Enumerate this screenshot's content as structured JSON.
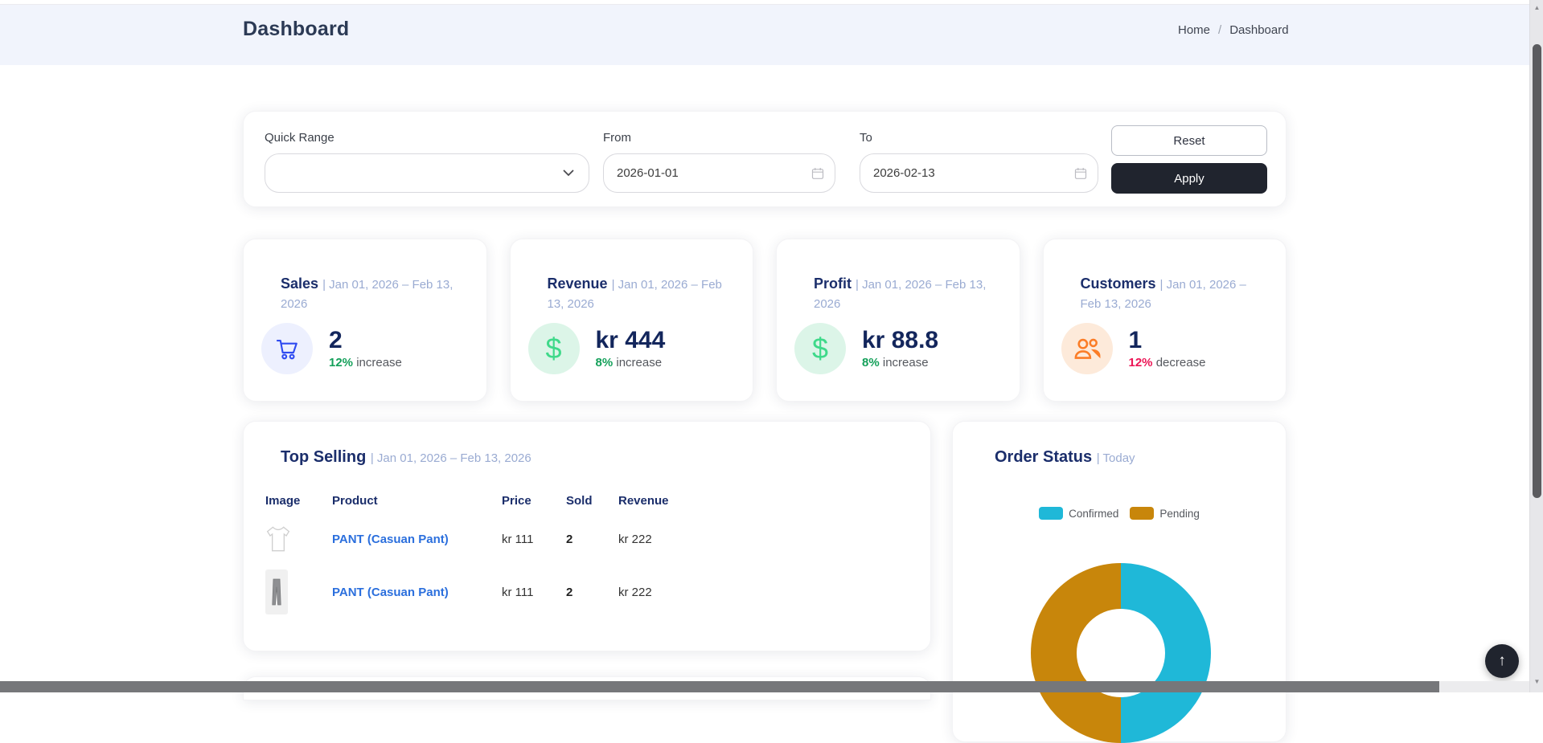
{
  "page": {
    "title": "Dashboard"
  },
  "breadcrumb": {
    "home": "Home",
    "separator": "/",
    "current": "Dashboard"
  },
  "filters": {
    "quick_range_label": "Quick Range",
    "quick_range_value": "",
    "from_label": "From",
    "from_value": "2026-01-01",
    "to_label": "To",
    "to_value": "2026-02-13",
    "reset_label": "Reset",
    "apply_label": "Apply"
  },
  "stats": [
    {
      "title": "Sales",
      "period": "| Jan 01, 2026 – Feb 13, 2026",
      "value": "2",
      "delta": "12%",
      "delta_dir": "increase",
      "delta_color": "#14a05a",
      "icon": "cart-icon",
      "icon_color": "#2f4bf0",
      "icon_bg": "#edf0fe"
    },
    {
      "title": "Revenue",
      "period": "| Jan 01, 2026 – Feb 13, 2026",
      "value": "kr 444",
      "delta": "8%",
      "delta_dir": "increase",
      "delta_color": "#14a05a",
      "icon": "dollar-icon",
      "icon_color": "#3fd98a",
      "icon_bg": "#dcf5e8"
    },
    {
      "title": "Profit",
      "period": "| Jan 01, 2026 – Feb 13, 2026",
      "value": "kr 88.8",
      "delta": "8%",
      "delta_dir": "increase",
      "delta_color": "#14a05a",
      "icon": "dollar-icon",
      "icon_color": "#3fd98a",
      "icon_bg": "#dcf5e8"
    },
    {
      "title": "Customers",
      "period": "| Jan 01, 2026 – Feb 13, 2026",
      "value": "1",
      "delta": "12%",
      "delta_dir": "decrease",
      "delta_color": "#ec1555",
      "icon": "users-icon",
      "icon_color": "#fb7d27",
      "icon_bg": "#fdeada"
    }
  ],
  "top_selling": {
    "title": "Top Selling",
    "period": "| Jan 01, 2026 – Feb 13, 2026",
    "columns": [
      "Image",
      "Product",
      "Price",
      "Sold",
      "Revenue"
    ],
    "rows": [
      {
        "image": "tshirt-image",
        "product": "PANT (Casuan Pant)",
        "price": "kr 111",
        "sold": "2",
        "revenue": "kr 222"
      },
      {
        "image": "pants-image",
        "product": "PANT (Casuan Pant)",
        "price": "kr 111",
        "sold": "2",
        "revenue": "kr 222"
      }
    ]
  },
  "order_status": {
    "title": "Order Status",
    "period": "| Today"
  },
  "chart_data": {
    "type": "pie",
    "title": "Order Status | Today",
    "labels": [
      "Confirmed",
      "Pending"
    ],
    "values": [
      50,
      50
    ],
    "colors": [
      "#1fb8d8",
      "#c8860b"
    ],
    "legend_position": "top",
    "style": "donut, right half Confirmed (cyan), left half Pending (gold), bottom clipped by viewport"
  },
  "scroll_top": {
    "icon": "arrow-up-icon",
    "glyph": "↑"
  },
  "scrollbar": {
    "up_glyph": "▲",
    "down_glyph": "▼"
  }
}
